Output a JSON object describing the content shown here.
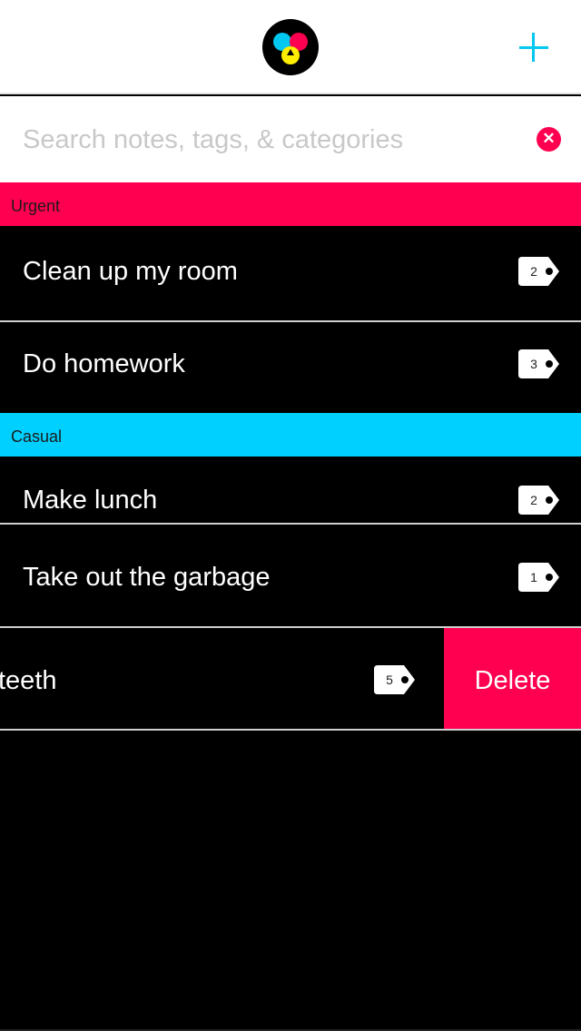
{
  "header": {
    "logo": "cmy-logo-icon",
    "add_icon": "plus-icon"
  },
  "search": {
    "placeholder": "Search notes, tags, & categories",
    "value": "",
    "clear_icon": "close-icon"
  },
  "sections": [
    {
      "label": "Urgent",
      "color": "#ff0050",
      "items": [
        {
          "title": "Clean up my room",
          "tags": "2"
        },
        {
          "title": "Do homework",
          "tags": "3"
        }
      ]
    },
    {
      "label": "Casual",
      "color": "#00d0ff",
      "items": [
        {
          "title": "Make lunch",
          "tags": "2"
        },
        {
          "title": "Take out the garbage",
          "tags": "1"
        },
        {
          "title": "teeth",
          "tags": "5"
        }
      ]
    }
  ],
  "swipe_action": {
    "label": "Delete",
    "color": "#ff0050"
  }
}
